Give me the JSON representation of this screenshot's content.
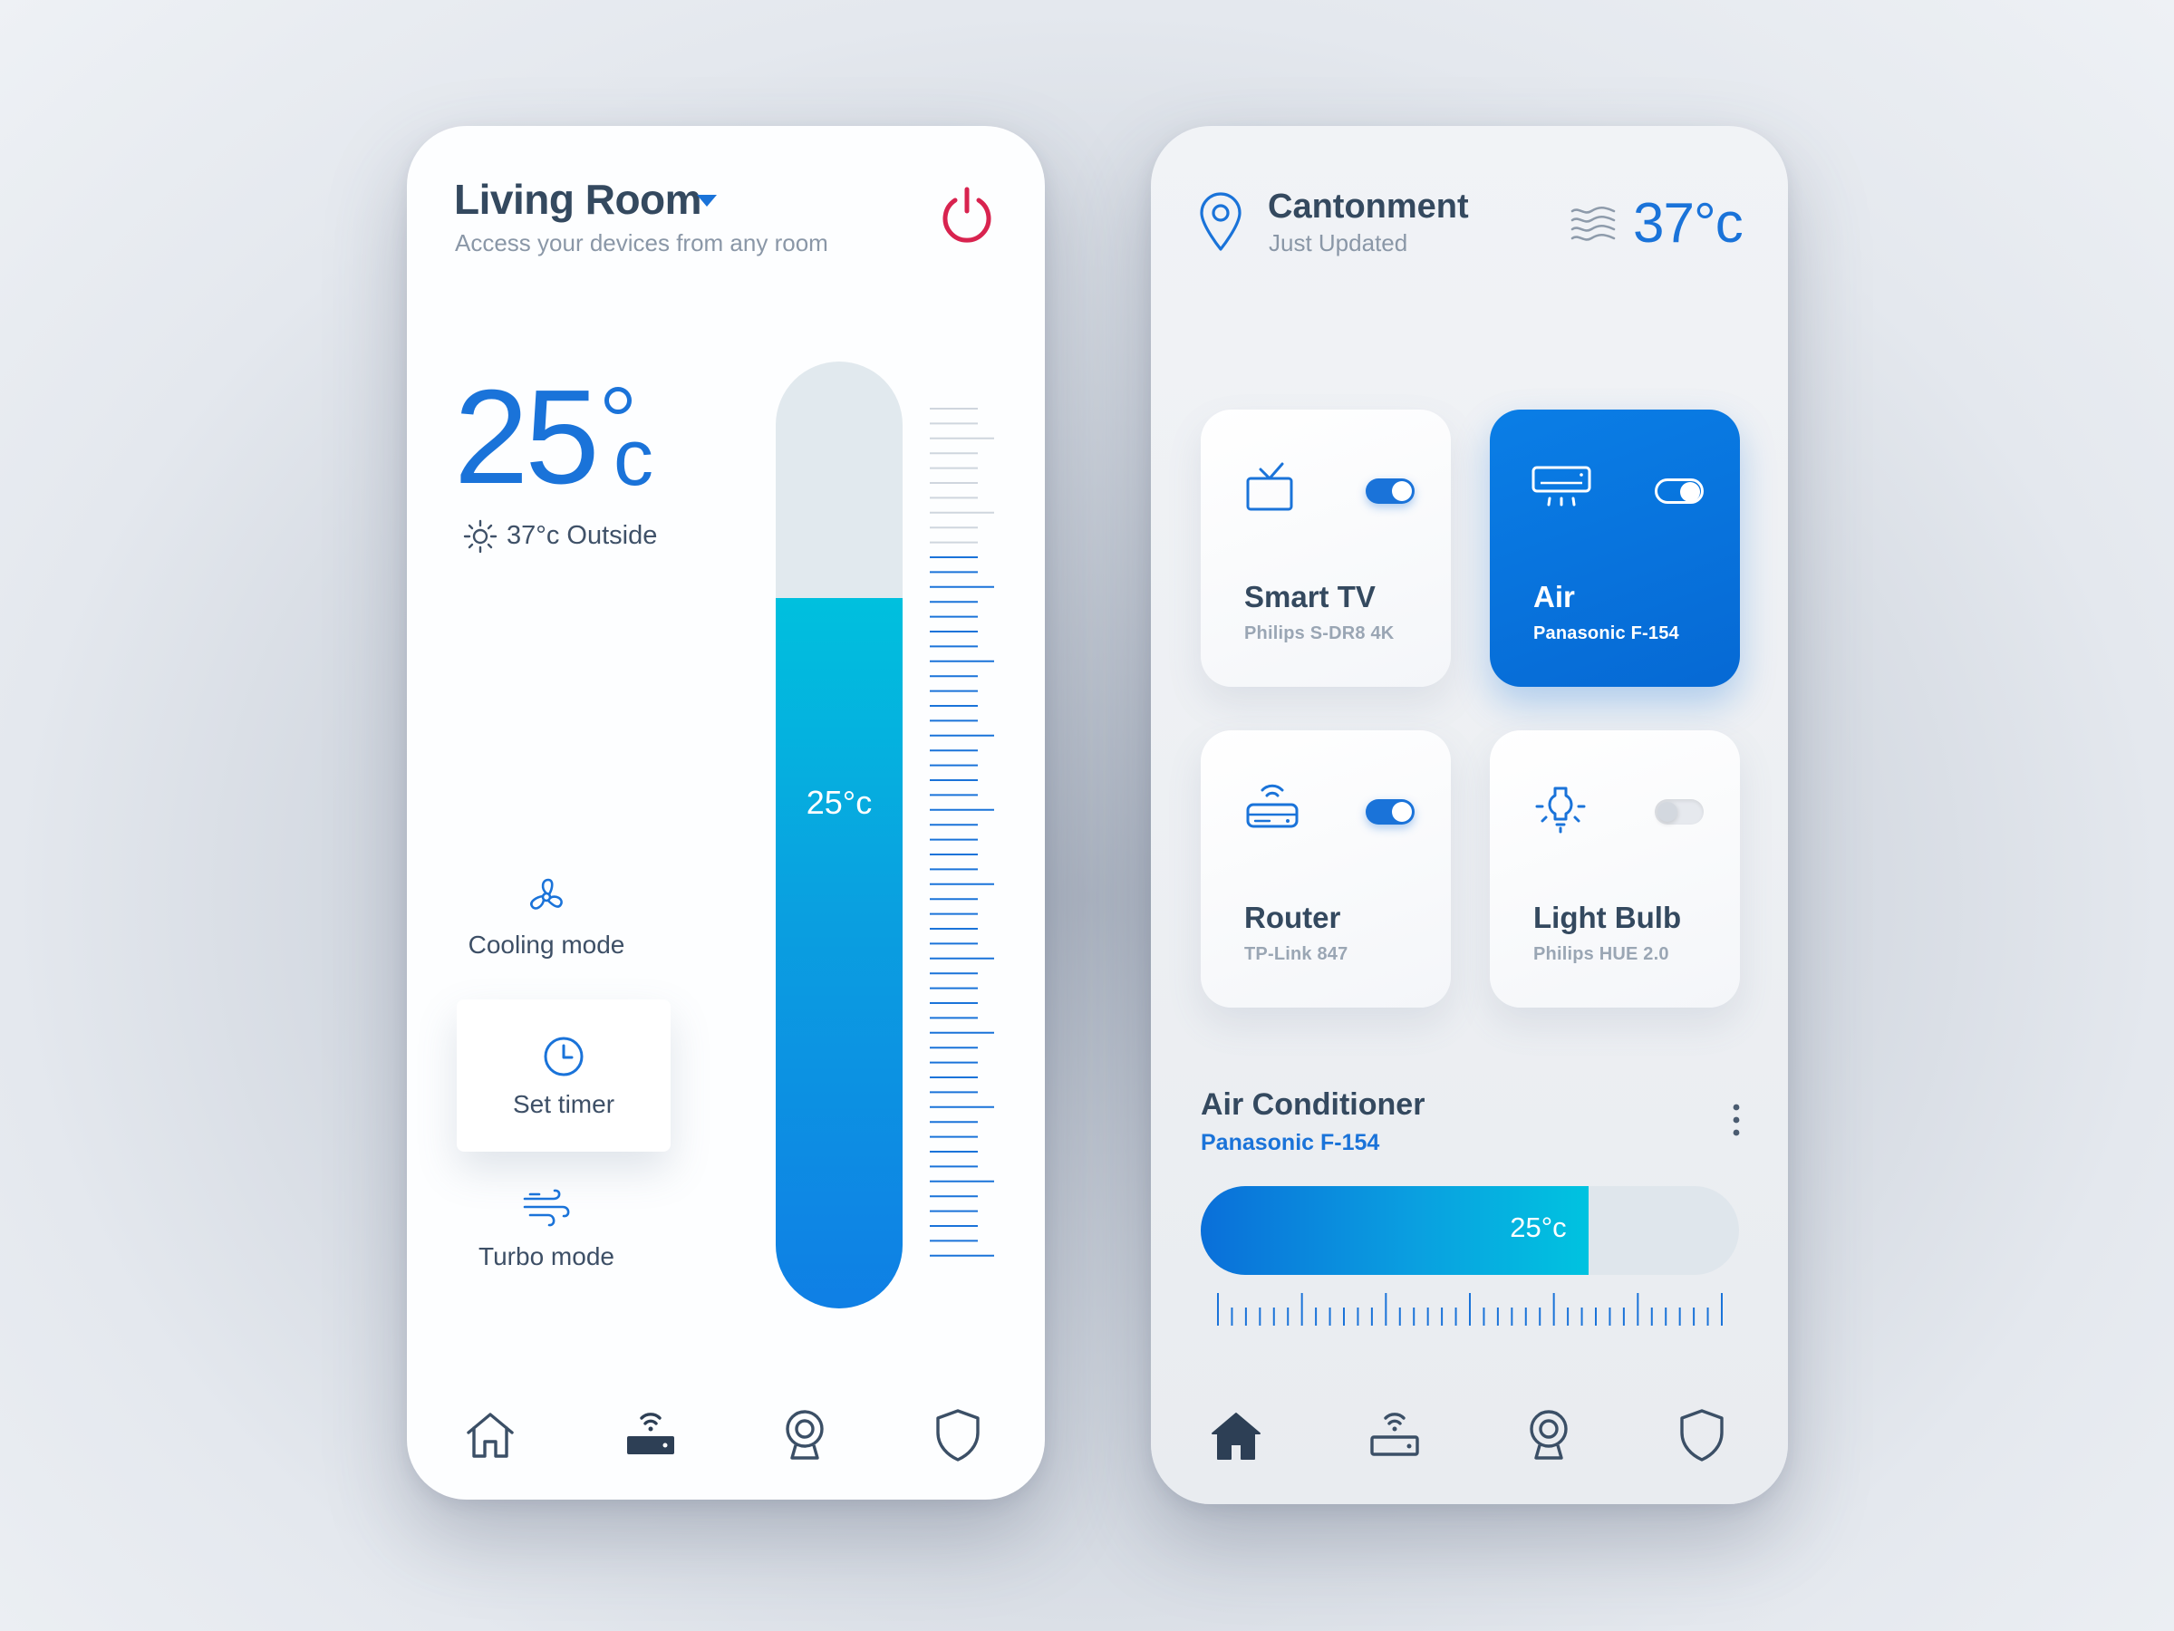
{
  "left_panel": {
    "room_title": "Living Room",
    "room_subtitle": "Access your devices from any room",
    "current_temp_value": "25",
    "current_temp_unit": "c",
    "outside_text": "37°c  Outside",
    "thermometer": {
      "label": "25°c",
      "level_percent": 75
    },
    "modes": [
      {
        "label": "Cooling mode",
        "icon": "fan-icon"
      },
      {
        "label": "Set timer",
        "icon": "clock-icon"
      },
      {
        "label": "Turbo mode",
        "icon": "wind-icon"
      }
    ],
    "nav": [
      "home-icon",
      "router-icon",
      "camera-icon",
      "shield-icon"
    ],
    "colors": {
      "accent": "#1a73d9",
      "power": "#d8234f"
    }
  },
  "right_panel": {
    "location_title": "Cantonment",
    "location_subtitle": "Just Updated",
    "weather_temp": "37°c",
    "devices": [
      {
        "name": "Smart TV",
        "model": "Philips S-DR8 4K",
        "on": true,
        "active": false,
        "icon": "tv-icon"
      },
      {
        "name": "Air",
        "model": "Panasonic F-154",
        "on": true,
        "active": true,
        "icon": "air-conditioner-icon"
      },
      {
        "name": "Router",
        "model": "TP-Link 847",
        "on": true,
        "active": false,
        "icon": "router-icon"
      },
      {
        "name": "Light Bulb",
        "model": "Philips HUE 2.0",
        "on": false,
        "active": false,
        "icon": "light-bulb-icon"
      }
    ],
    "ac": {
      "title": "Air Conditioner",
      "model": "Panasonic F-154",
      "value_label": "25°c",
      "level_percent": 72
    },
    "nav": [
      "home-icon",
      "router-icon",
      "camera-icon",
      "shield-icon"
    ],
    "colors": {
      "accent": "#1a73d9",
      "active_card": "#0a7ee6"
    }
  }
}
